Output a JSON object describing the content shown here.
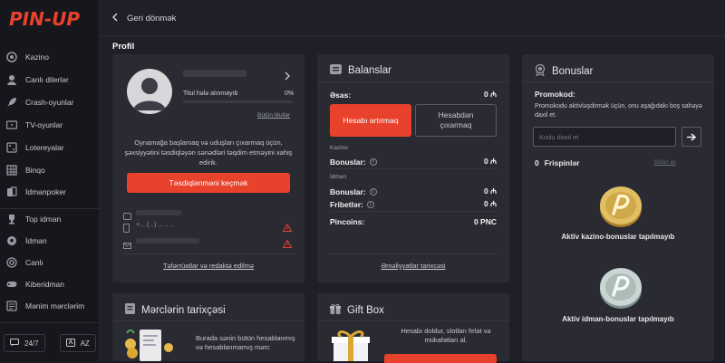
{
  "brand": {
    "logo_text": "PIN-UP",
    "accent": "#e8412c"
  },
  "sidebar": {
    "items": [
      {
        "label": "Kazino",
        "icon": "casino-chip-icon"
      },
      {
        "label": "Canlı dilerlər",
        "icon": "live-dealer-icon"
      },
      {
        "label": "Crash-oyunlar",
        "icon": "rocket-icon"
      },
      {
        "label": "TV-oyunlar",
        "icon": "tv-icon"
      },
      {
        "label": "Lotereyalar",
        "icon": "lottery-icon"
      },
      {
        "label": "Binqo",
        "icon": "bingo-icon"
      },
      {
        "label": "İdmanpoker",
        "icon": "cards-icon"
      },
      {
        "label": "Top idman",
        "icon": "trophy-icon"
      },
      {
        "label": "İdman",
        "icon": "soccer-ball-icon"
      },
      {
        "label": "Canlı",
        "icon": "live-icon"
      },
      {
        "label": "Kiberidman",
        "icon": "gamepad-icon"
      },
      {
        "label": "Mənim mərclərim",
        "icon": "bets-icon"
      }
    ],
    "support_label": "24/7",
    "language_label": "AZ"
  },
  "header": {
    "back_label": "Geri dönmək",
    "page_title": "Profil"
  },
  "profile": {
    "title_status": "Titul hələ alınmayıb",
    "progress_label": "0%",
    "progress_value": 0,
    "all_titles_link": "Bütün titullar",
    "verify_text": "Oynamağa başlamaq və uduşları çıxarmaq üçün, şəxsiyyətini təsdiqləyən sənədləri təqdim etməyini xahiş edirik.",
    "verify_button": "Təsdiqlənməni keçmək",
    "phone_value": "+... (...) ... .. ..",
    "details_link": "Təfərrüatlar və redaktə edilmə"
  },
  "balance": {
    "title": "Balanslar",
    "main_label": "Əsas:",
    "main_value": "0 ₼",
    "deposit_button": "Hesabı artırmaq",
    "withdraw_button": "Hesabdan çıxarmaq",
    "casino_section": "Kazino",
    "casino_bonus_label": "Bonuslar:",
    "casino_bonus_value": "0 ₼",
    "sport_section": "İdman",
    "sport_bonus_label": "Bonuslar:",
    "sport_bonus_value": "0 ₼",
    "freebets_label": "Fribetlər:",
    "freebets_value": "0 ₼",
    "pincoins_label": "Pincoins:",
    "pincoins_value": "0 PNC",
    "history_link": "Əməliyyatlar tarixcəsi"
  },
  "bonuses": {
    "title": "Bonuslar",
    "promo_title": "Promokod:",
    "promo_desc": "Promokodu aktivləşdirmək üçün, onu aşağıdakı boş sahəyə daxil et.",
    "promo_placeholder": "Kodu daxil et",
    "freespins_count": "0",
    "freespins_label": "Frispinlər",
    "freespins_link": "Bütün aç",
    "casino_empty": "Aktiv kazino-bonuslar tapılmayıb",
    "sport_empty": "Aktiv idman-bonuslar tapılmayıb"
  },
  "bets_history": {
    "title": "Mərclərin tarixçəsi",
    "text": "Burada sənin bütün hesablanmış və hesablanmamış mərc"
  },
  "gift_box": {
    "title": "Gift Box",
    "text": "Hesabı doldur, slotları fırlat və mükafatları al."
  }
}
